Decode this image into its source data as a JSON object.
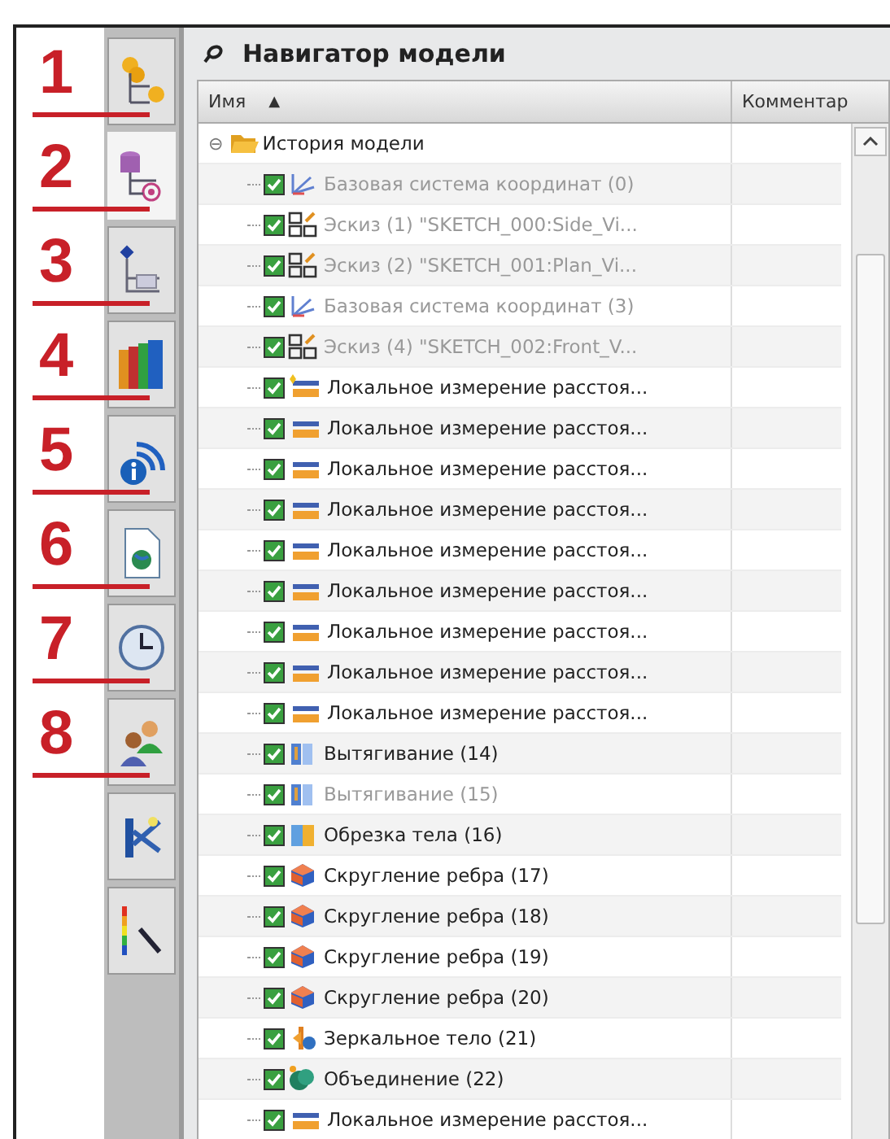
{
  "sidebar": {
    "tabs": [
      {
        "kind": "assembly",
        "callout": "1",
        "selected": false
      },
      {
        "kind": "part",
        "callout": "2",
        "selected": true
      },
      {
        "kind": "constraint",
        "callout": "3",
        "selected": false
      },
      {
        "kind": "library",
        "callout": "4",
        "selected": false
      },
      {
        "kind": "info",
        "callout": "5",
        "selected": false
      },
      {
        "kind": "document",
        "callout": "6",
        "selected": false
      },
      {
        "kind": "history",
        "callout": "7",
        "selected": false
      },
      {
        "kind": "roles",
        "callout": "8",
        "selected": false
      },
      {
        "kind": "tools",
        "selected": false
      },
      {
        "kind": "palette",
        "selected": false
      }
    ]
  },
  "navigator": {
    "title": "Навигатор модели",
    "columns": [
      {
        "label": "Имя",
        "sort": "▲"
      },
      {
        "label": "Комментар"
      }
    ],
    "tree": {
      "label": "История модели",
      "expanded": true,
      "expander": "⊖",
      "children": [
        {
          "kind": "csys",
          "label": "Базовая система координат (0)",
          "checked": true,
          "dimmed": true
        },
        {
          "kind": "sketch",
          "label": "Эскиз (1) \"SKETCH_000:Side_Vi...",
          "checked": true,
          "dimmed": true
        },
        {
          "kind": "sketch",
          "label": "Эскиз (2) \"SKETCH_001:Plan_Vi...",
          "checked": true,
          "dimmed": true
        },
        {
          "kind": "csys",
          "label": "Базовая система координат (3)",
          "checked": true,
          "dimmed": true
        },
        {
          "kind": "sketch",
          "label": "Эскиз (4) \"SKETCH_002:Front_V...",
          "checked": true,
          "dimmed": true
        },
        {
          "kind": "measure",
          "label": "Локальное измерение расстоя...",
          "checked": true,
          "dimmed": false,
          "current": true
        },
        {
          "kind": "measure",
          "label": "Локальное измерение расстоя...",
          "checked": true,
          "dimmed": false,
          "current": false
        },
        {
          "kind": "measure",
          "label": "Локальное измерение расстоя...",
          "checked": true,
          "dimmed": false,
          "current": false
        },
        {
          "kind": "measure",
          "label": "Локальное измерение расстоя...",
          "checked": true,
          "dimmed": false,
          "current": false
        },
        {
          "kind": "measure",
          "label": "Локальное измерение расстоя...",
          "checked": true,
          "dimmed": false,
          "current": false
        },
        {
          "kind": "measure",
          "label": "Локальное измерение расстоя...",
          "checked": true,
          "dimmed": false,
          "current": false
        },
        {
          "kind": "measure",
          "label": "Локальное измерение расстоя...",
          "checked": true,
          "dimmed": false,
          "current": false
        },
        {
          "kind": "measure",
          "label": "Локальное измерение расстоя...",
          "checked": true,
          "dimmed": false,
          "current": false
        },
        {
          "kind": "measure",
          "label": "Локальное измерение расстоя...",
          "checked": true,
          "dimmed": false,
          "current": false
        },
        {
          "kind": "extrude",
          "label": "Вытягивание (14)",
          "checked": true,
          "dimmed": false
        },
        {
          "kind": "extrude",
          "label": "Вытягивание (15)",
          "checked": true,
          "dimmed": true
        },
        {
          "kind": "trim",
          "label": "Обрезка тела (16)",
          "checked": true,
          "dimmed": false
        },
        {
          "kind": "blend",
          "label": "Скругление ребра (17)",
          "checked": true,
          "dimmed": false
        },
        {
          "kind": "blend",
          "label": "Скругление ребра (18)",
          "checked": true,
          "dimmed": false
        },
        {
          "kind": "blend",
          "label": "Скругление ребра (19)",
          "checked": true,
          "dimmed": false
        },
        {
          "kind": "blend",
          "label": "Скругление ребра (20)",
          "checked": true,
          "dimmed": false
        },
        {
          "kind": "mirror",
          "label": "Зеркальное тело (21)",
          "checked": true,
          "dimmed": false
        },
        {
          "kind": "unite",
          "label": "Объединение (22)",
          "checked": true,
          "dimmed": false
        },
        {
          "kind": "measure",
          "label": "Локальное измерение расстоя...",
          "checked": true,
          "dimmed": false,
          "current": false
        }
      ]
    }
  }
}
